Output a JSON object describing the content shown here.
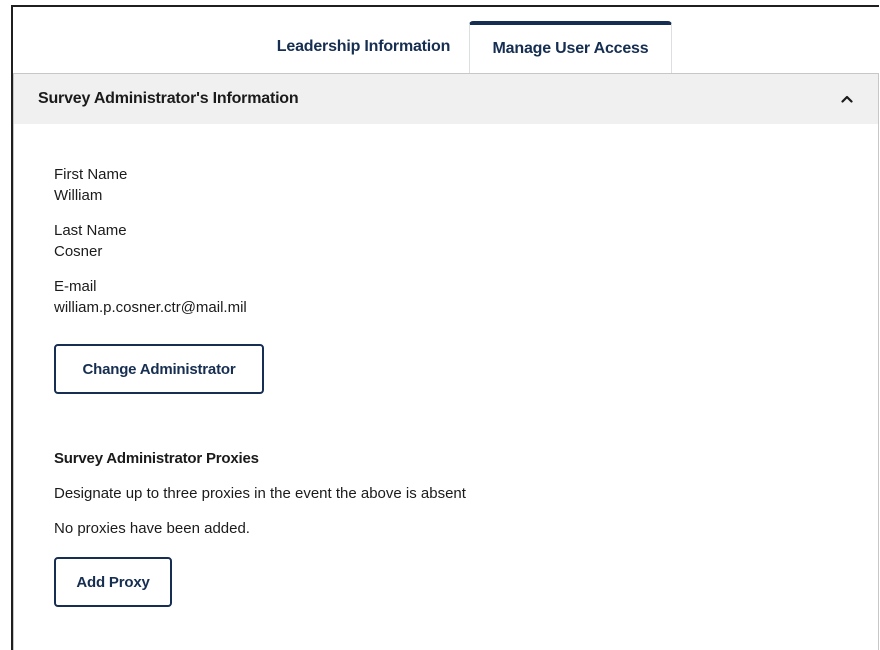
{
  "tabs": [
    {
      "label": "Leadership Information"
    },
    {
      "label": "Manage User Access"
    }
  ],
  "accordion": {
    "title": "Survey Administrator's Information",
    "chevron_icon": "chevron-up-icon"
  },
  "administrator": {
    "first_name_label": "First Name",
    "first_name": "William",
    "last_name_label": "Last Name",
    "last_name": "Cosner",
    "email_label": "E-mail",
    "email": "william.p.cosner.ctr@mail.mil",
    "change_button": "Change Administrator"
  },
  "proxies": {
    "title": "Survey Administrator Proxies",
    "description": "Designate up to three proxies in the event the above is absent",
    "empty_text": "No proxies have been added.",
    "add_button": "Add Proxy"
  },
  "colors": {
    "primary": "#162e51",
    "header_bg": "#f0f0f0"
  }
}
